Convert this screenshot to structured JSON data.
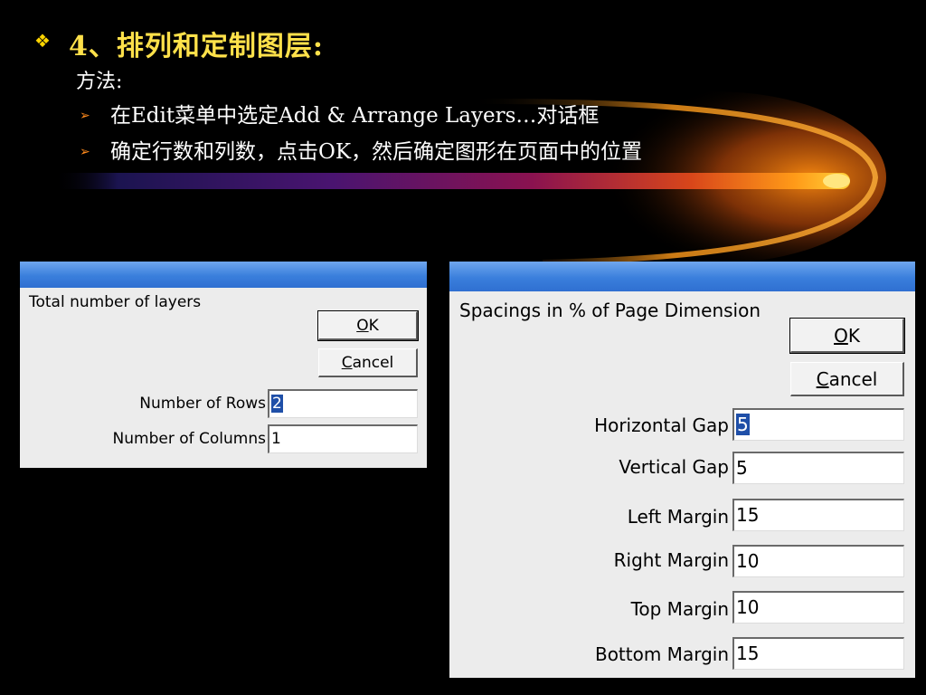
{
  "slide": {
    "bullet_icon": "diamond-bullet-icon",
    "title": "4、排列和定制图层:",
    "method_label": "方法:",
    "items": [
      "在Edit菜单中选定Add & Arrange Layers…对话框",
      "确定行数和列数，点击OK，然后确定图形在页面中的位置"
    ],
    "item_marker": "➢",
    "colors": {
      "title": "#ffe14a",
      "bullet": "#ffd400",
      "arrow": "#ff8a1c",
      "background": "#000000"
    }
  },
  "dialog_layers": {
    "heading": "Total number of layers",
    "ok_label": "OK",
    "ok_accel": "O",
    "ok_rest": "K",
    "cancel_accel": "C",
    "cancel_rest": "ancel",
    "rows_label": "Number of Rows",
    "rows_value": "2",
    "columns_label": "Number of Columns",
    "columns_value": "1"
  },
  "dialog_spacing": {
    "heading": "Spacings in % of Page Dimension",
    "ok_accel": "O",
    "ok_rest": "K",
    "cancel_accel": "C",
    "cancel_rest": "ancel",
    "fields": [
      {
        "label": "Horizontal Gap",
        "value": "5"
      },
      {
        "label": "Vertical Gap",
        "value": "5"
      },
      {
        "label": "Left Margin",
        "value": "15"
      },
      {
        "label": "Right Margin",
        "value": "10"
      },
      {
        "label": "Top Margin",
        "value": "10"
      },
      {
        "label": "Bottom Margin",
        "value": "15"
      }
    ]
  }
}
